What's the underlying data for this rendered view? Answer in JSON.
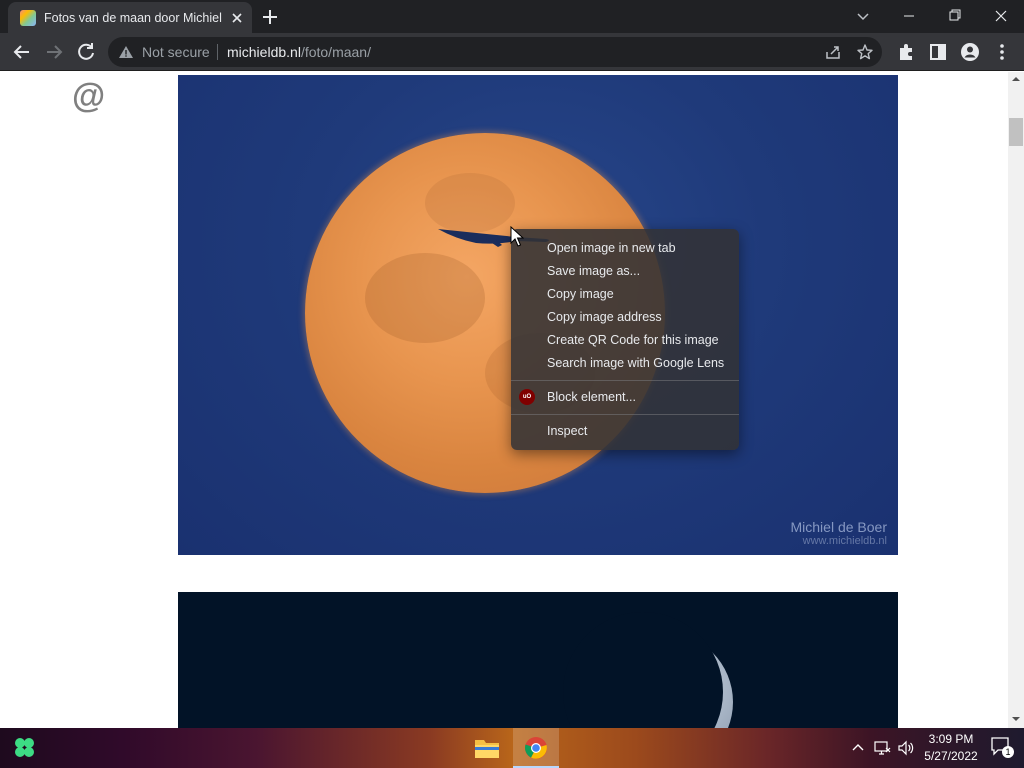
{
  "tab": {
    "title": "Fotos van de maan door Michiel de Boer"
  },
  "omnibox": {
    "security_label": "Not secure",
    "url_host": "michieldb.nl",
    "url_path": "/foto/maan/"
  },
  "page": {
    "logo_text": "@",
    "photo_watermark_name": "Michiel de Boer",
    "photo_watermark_site": "www.michieldb.nl"
  },
  "context_menu": {
    "items": [
      {
        "label": "Open image in new tab"
      },
      {
        "label": "Save image as..."
      },
      {
        "label": "Copy image"
      },
      {
        "label": "Copy image address"
      },
      {
        "label": "Create QR Code for this image"
      },
      {
        "label": "Search image with Google Lens"
      },
      {
        "label": "Block element..."
      },
      {
        "label": "Inspect"
      }
    ],
    "ublock_icon_text": "uO"
  },
  "taskbar": {
    "time": "3:09 PM",
    "date": "5/27/2022",
    "notification_count": "1"
  },
  "colors": {
    "tab_strip": "#202124",
    "toolbar": "#35363a",
    "accent_ublock": "#800000"
  }
}
